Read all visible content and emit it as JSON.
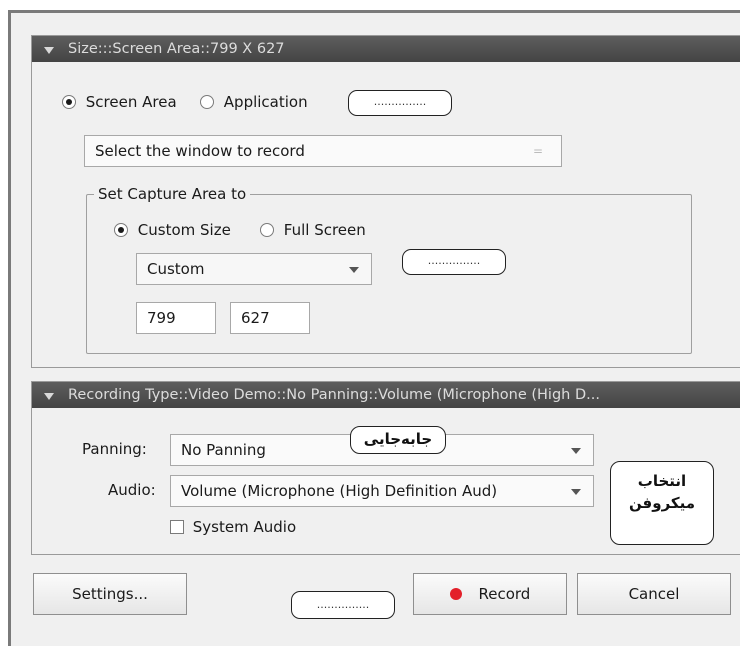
{
  "size_panel": {
    "header": "Size:::Screen Area::799 X 627",
    "radio_screen_area": "Screen Area",
    "radio_application": "Application",
    "placeholder_dots_1": "...............",
    "window_select": "Select the window to record",
    "capture_group_label": "Set Capture Area to",
    "radio_custom_size": "Custom Size",
    "radio_full_screen": "Full Screen",
    "size_preset": "Custom",
    "placeholder_dots_2": "...............",
    "width_value": "799",
    "height_value": "627"
  },
  "recording_panel": {
    "header": "Recording Type::Video Demo::No Panning::Volume (Microphone (High D...",
    "panning_label": "Panning:",
    "panning_value": "No Panning",
    "panning_note": "جابه‌جایی",
    "audio_label": "Audio:",
    "audio_value": "Volume (Microphone (High Definition Aud)",
    "system_audio_label": "System Audio",
    "mic_note_line1": "انتخاب",
    "mic_note_line2": "میکروفن"
  },
  "footer": {
    "settings_label": "Settings...",
    "placeholder_dots_3": "...............",
    "record_label": "Record",
    "cancel_label": "Cancel"
  },
  "colors": {
    "header_bg": "#4f4f4f",
    "record_dot": "#e3202a"
  }
}
